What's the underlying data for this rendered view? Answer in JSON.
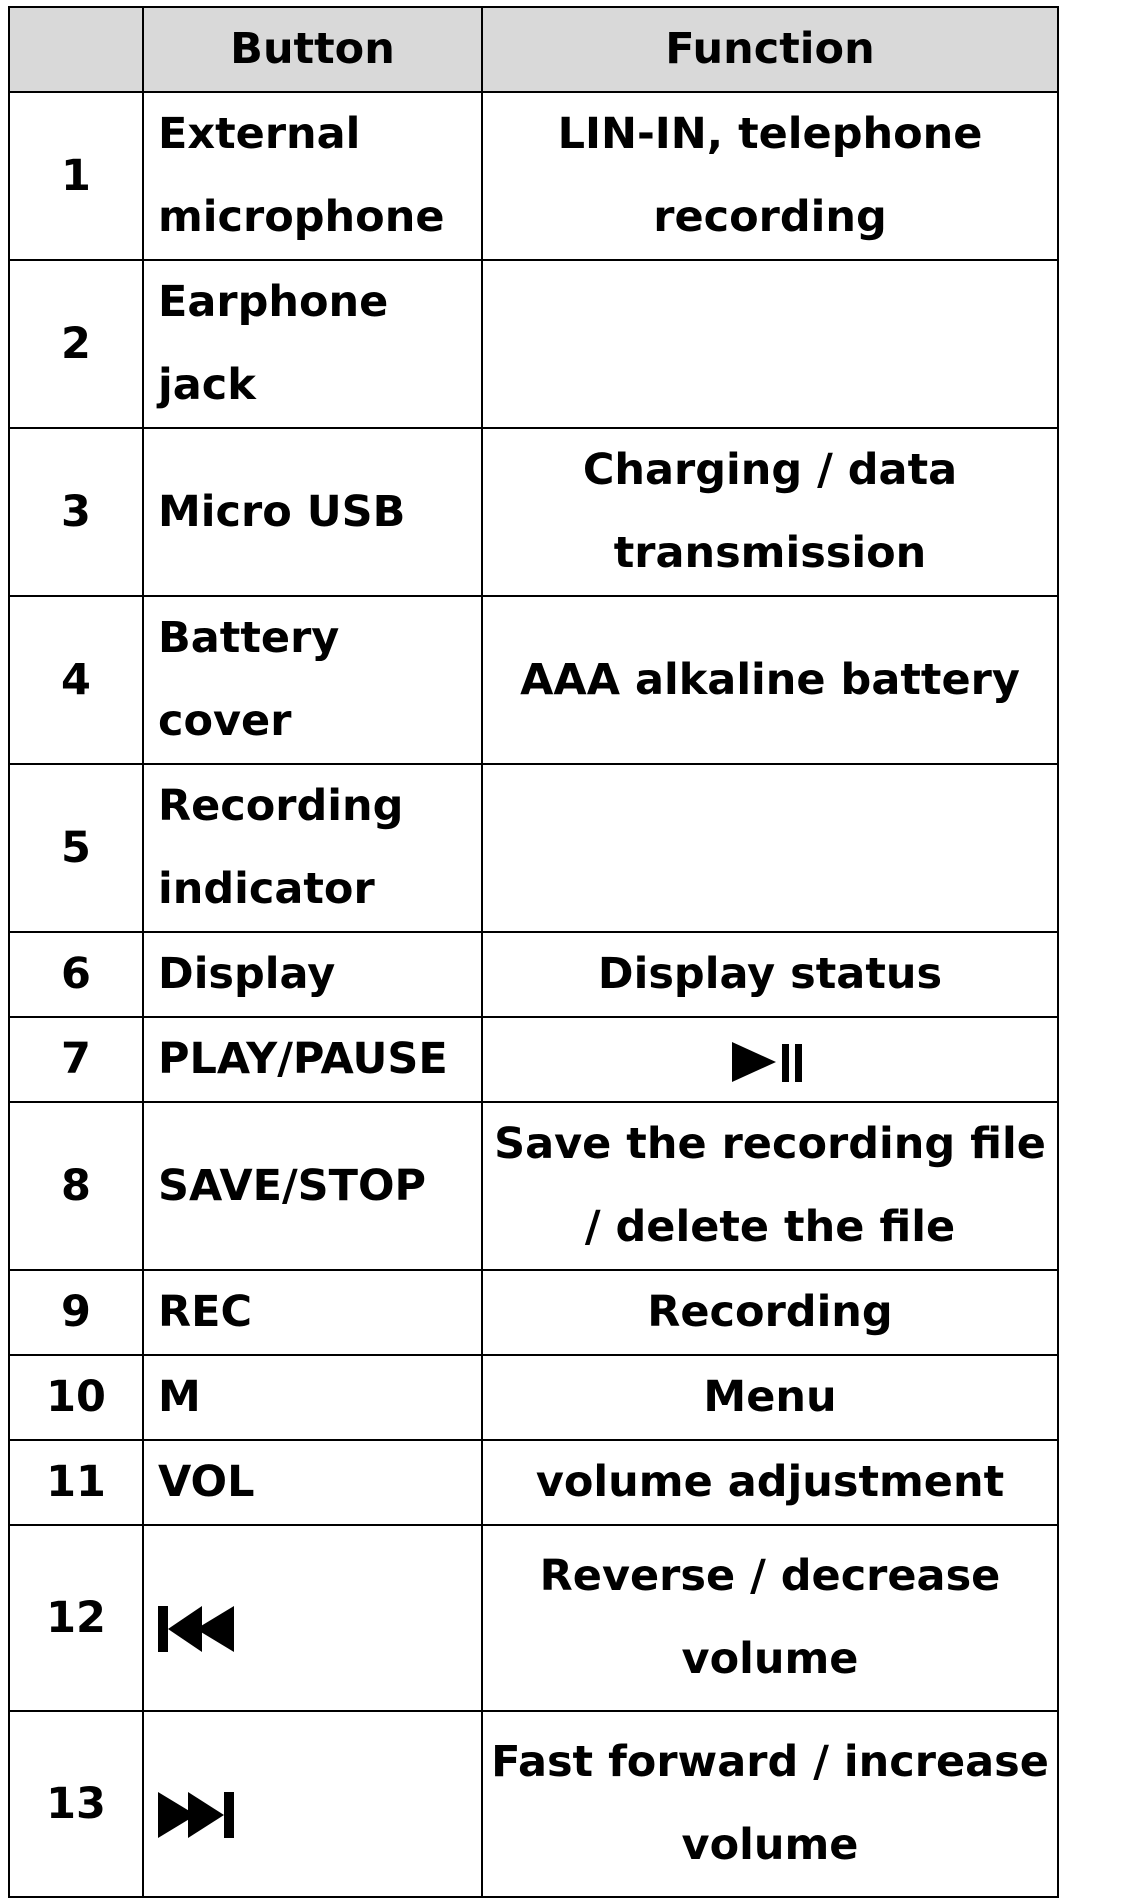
{
  "table": {
    "headers": {
      "index": "",
      "button": "Button",
      "function": "Function"
    },
    "rows": [
      {
        "num": "1",
        "button": "External microphone",
        "function": "LIN-IN, telephone recording"
      },
      {
        "num": "2",
        "button": "Earphone jack",
        "function": ""
      },
      {
        "num": "3",
        "button": "Micro USB",
        "function": "Charging / data transmission"
      },
      {
        "num": "4",
        "button": "Battery cover",
        "function": "AAA alkaline battery"
      },
      {
        "num": "5",
        "button": "Recording indicator",
        "function": ""
      },
      {
        "num": "6",
        "button": "Display",
        "function": "Display status"
      },
      {
        "num": "7",
        "button": "PLAY/PAUSE",
        "function_icon": "play-pause-icon"
      },
      {
        "num": "8",
        "button": "SAVE/STOP",
        "function": "Save the recording file / delete the file"
      },
      {
        "num": "9",
        "button": "REC",
        "function": "Recording"
      },
      {
        "num": "10",
        "button": "M",
        "function": "Menu"
      },
      {
        "num": "11",
        "button": "VOL",
        "function": "volume adjustment"
      },
      {
        "num": "12",
        "button_icon": "skip-back-icon",
        "function": "Reverse / decrease volume"
      },
      {
        "num": "13",
        "button_icon": "skip-forward-icon",
        "function": "Fast forward / increase volume"
      }
    ]
  },
  "colors": {
    "header_background": "#d9d9d9",
    "border": "#000000",
    "text": "#000000"
  }
}
